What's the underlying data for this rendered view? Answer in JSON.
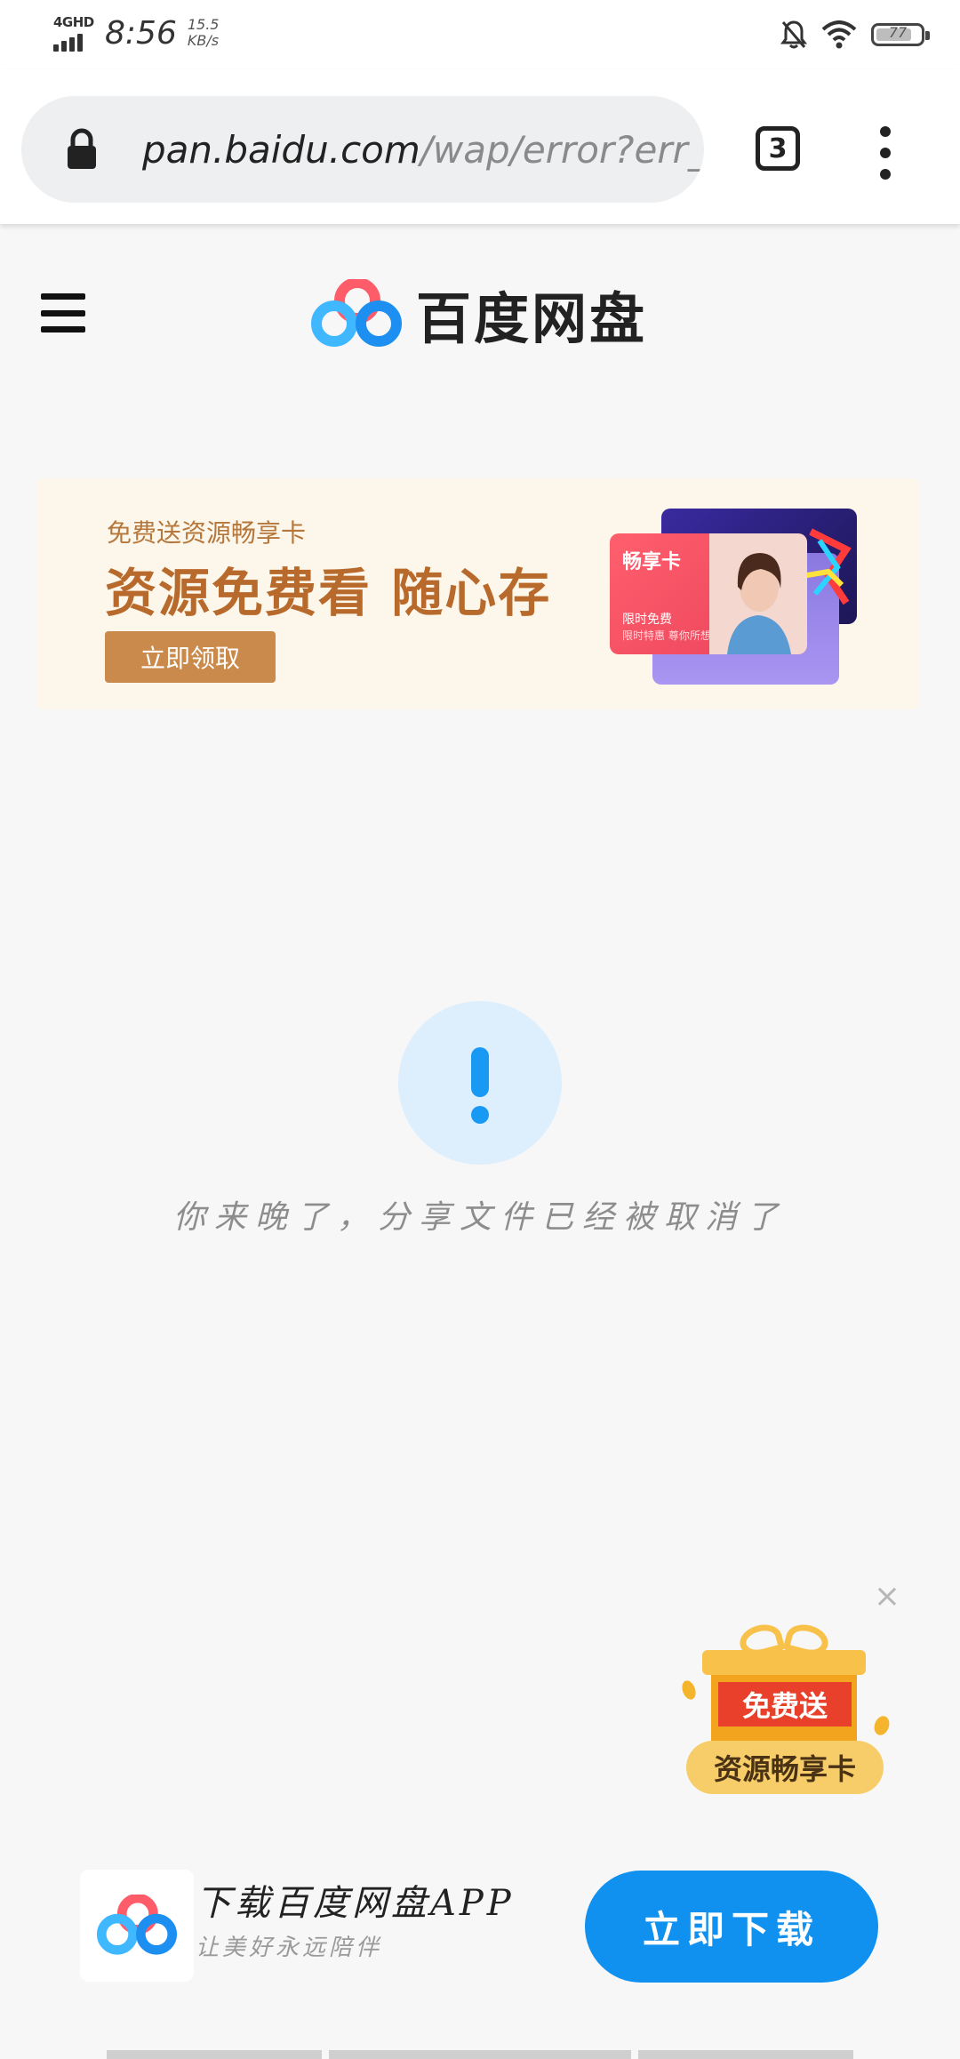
{
  "status_bar": {
    "network": "4GHD",
    "time": "8:56",
    "speed_value": "15.5",
    "speed_unit": "KB/s",
    "battery": "77",
    "icons": [
      "signal-icon",
      "bell-off-icon",
      "wifi-icon",
      "battery-icon"
    ]
  },
  "browser": {
    "url_host": "pan.baidu.com",
    "url_path": "/wap/error?err_nu",
    "tab_count": "3",
    "icons": [
      "lock-icon",
      "more-vertical-icon"
    ]
  },
  "header": {
    "logo_text": "百度网盘",
    "icons": [
      "menu-icon",
      "baidu-netdisk-logo"
    ]
  },
  "banner": {
    "subtitle": "免费送资源畅享卡",
    "title": "资源免费看 随心存",
    "button": "立即领取",
    "card_title": "畅享卡",
    "card_line1": "限时免费",
    "card_line2": "限时特惠 尊你所想"
  },
  "error": {
    "message": "你来晚了，分享文件已经被取消了",
    "accent": "#1799f4"
  },
  "gift": {
    "badge_top": "免费送",
    "badge_bottom": "资源畅享卡",
    "close_symbol": "×"
  },
  "app_bar": {
    "title": "下载百度网盘APP",
    "subtitle": "让美好永远陪伴",
    "button": "立即下载",
    "accent": "#1191ef"
  }
}
